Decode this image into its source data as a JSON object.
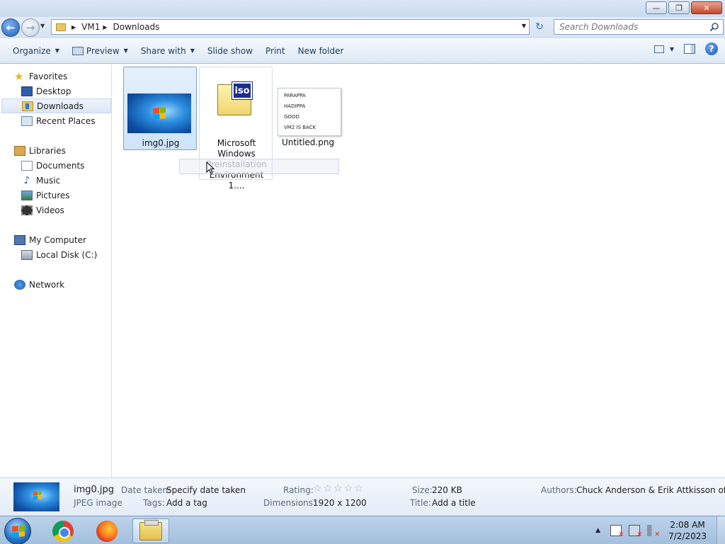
{
  "window": {
    "minimize": "—",
    "maximize": "❐",
    "close": "✕"
  },
  "address": {
    "crumbs": [
      "VM1",
      "Downloads"
    ],
    "search_placeholder": "Search Downloads"
  },
  "toolbar": {
    "organize": "Organize",
    "preview": "Preview",
    "share_with": "Share with",
    "slide_show": "Slide show",
    "print": "Print",
    "new_folder": "New folder",
    "help": "?"
  },
  "sidebar": {
    "favorites": {
      "label": "Favorites",
      "items": [
        "Desktop",
        "Downloads",
        "Recent Places"
      ]
    },
    "libraries": {
      "label": "Libraries",
      "items": [
        "Documents",
        "Music",
        "Pictures",
        "Videos"
      ]
    },
    "computer": {
      "label": "My Computer",
      "items": [
        "Local Disk (C:)"
      ]
    },
    "network": {
      "label": "Network"
    }
  },
  "files": [
    {
      "name": "img0.jpg",
      "icon": "windows-wallpaper-thumbnail",
      "selected": true
    },
    {
      "name": "Microsoft Windows Preinstallation Environment 1....",
      "name_lines": [
        "Microsoft",
        "Windows",
        "Preinstallation",
        "Environment 1...."
      ],
      "icon": "iso-file-icon",
      "selected": false
    },
    {
      "name": "Untitled.png",
      "icon": "png-thumbnail",
      "thumb_text": [
        "PARAPPA",
        "HADIPPA",
        "GOOD",
        "VM2 IS BACK"
      ],
      "selected": false
    }
  ],
  "details": {
    "name": "img0.jpg",
    "type": "JPEG image",
    "date_taken_label": "Date taken:",
    "date_taken_value": "Specify date taken",
    "tags_label": "Tags:",
    "tags_value": "Add a tag",
    "rating_label": "Rating:",
    "rating_value": 0,
    "rating_max": 5,
    "dimensions_label": "Dimensions:",
    "dimensions_value": "1920 x 1200",
    "size_label": "Size:",
    "size_value": "220 KB",
    "title_label": "Title:",
    "title_value": "Add a title",
    "authors_label": "Authors:",
    "authors_value": "Chuck Anderson & Erik Attkisson of..."
  },
  "taskbar": {
    "apps": [
      "chrome",
      "firefox",
      "windows-explorer"
    ],
    "active_app": "windows-explorer",
    "time": "2:08 AM",
    "date": "7/2/2023"
  },
  "colors": {
    "selection_bg": "#cfe3fa",
    "selection_border": "#7da2ce",
    "toolbar_text": "#1e395b",
    "taskbar_bg": "#a3bfdc"
  }
}
